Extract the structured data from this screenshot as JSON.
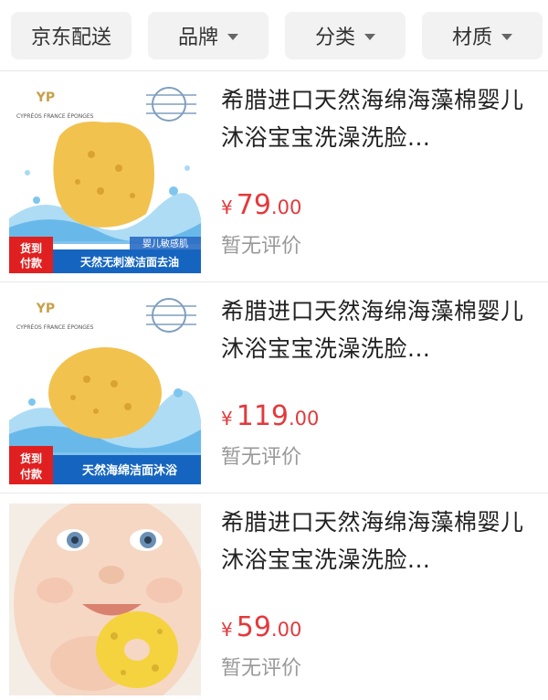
{
  "filters": [
    {
      "label": "京东配送",
      "has_dropdown": false
    },
    {
      "label": "品牌",
      "has_dropdown": true
    },
    {
      "label": "分类",
      "has_dropdown": true
    },
    {
      "label": "材质",
      "has_dropdown": true
    }
  ],
  "products": [
    {
      "title": "希腊进口天然海绵海藻棉婴儿沐浴宝宝洗澡洗脸...",
      "currency": "¥",
      "price_int": "79",
      "price_dec": ".00",
      "review": "暂无评价",
      "image": {
        "brand_text": "CYPRÉOS FRANCE ÉPONGES",
        "badge": "货到付款",
        "banner": "天然无刺激洁面去油",
        "tag": "婴儿敏感肌"
      }
    },
    {
      "title": "希腊进口天然海绵海藻棉婴儿沐浴宝宝洗澡洗脸...",
      "currency": "¥",
      "price_int": "119",
      "price_dec": ".00",
      "review": "暂无评价",
      "image": {
        "brand_text": "CYPRÉOS FRANCE ÉPONGES",
        "badge": "货到付款",
        "banner": "天然海绵洁面沐浴",
        "tag": ""
      }
    },
    {
      "title": "希腊进口天然海绵海藻棉婴儿沐浴宝宝洗澡洗脸...",
      "currency": "¥",
      "price_int": "59",
      "price_dec": ".00",
      "review": "暂无评价",
      "image": {
        "brand_text": "",
        "badge": "",
        "banner": "",
        "tag": ""
      }
    }
  ],
  "colors": {
    "price": "#e4393c",
    "badge_bg": "#e02020",
    "banner_bg": "#1565c0",
    "sponge": "#f2c24e"
  }
}
